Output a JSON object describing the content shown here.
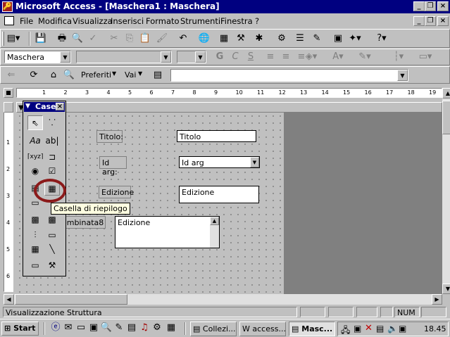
{
  "window": {
    "title": "Microsoft Access - [Maschera1 : Maschera]",
    "min": "_",
    "restore": "❐",
    "close": "×"
  },
  "menu": {
    "items": [
      "File",
      "Modifica",
      "Visualizza",
      "Inserisci",
      "Formato",
      "Strumenti",
      "Finestra",
      "?"
    ]
  },
  "format_toolbar": {
    "object_select": "Maschera",
    "font_select": "",
    "size_select": ""
  },
  "web_toolbar": {
    "preferiti": "Preferiti",
    "vai": "Vai",
    "address": ""
  },
  "toolbox": {
    "title": "Case"
  },
  "form": {
    "fields": [
      {
        "label": "Titolo:",
        "value": "Titolo"
      },
      {
        "label": "Id arg:",
        "value": "Id arg"
      },
      {
        "label": "Edizione",
        "value": "Edizione"
      }
    ],
    "combo_label": "ombinata8",
    "list_value": "Edizione"
  },
  "tooltip": "Casella di riepilogo",
  "status": {
    "text": "Visualizzazione Struttura",
    "num": "NUM"
  },
  "taskbar": {
    "start": "Start",
    "tasks": [
      "Collezi...",
      "access...",
      "Masc..."
    ],
    "clock": "18.45"
  },
  "ruler": {
    "h_numbers": [
      "1",
      "2",
      "3",
      "4",
      "5",
      "6",
      "7",
      "8",
      "9",
      "10",
      "11",
      "12",
      "13",
      "14",
      "15",
      "16",
      "17",
      "18",
      "19"
    ],
    "v_numbers": [
      "1",
      "2",
      "3",
      "4",
      "5",
      "6"
    ]
  }
}
